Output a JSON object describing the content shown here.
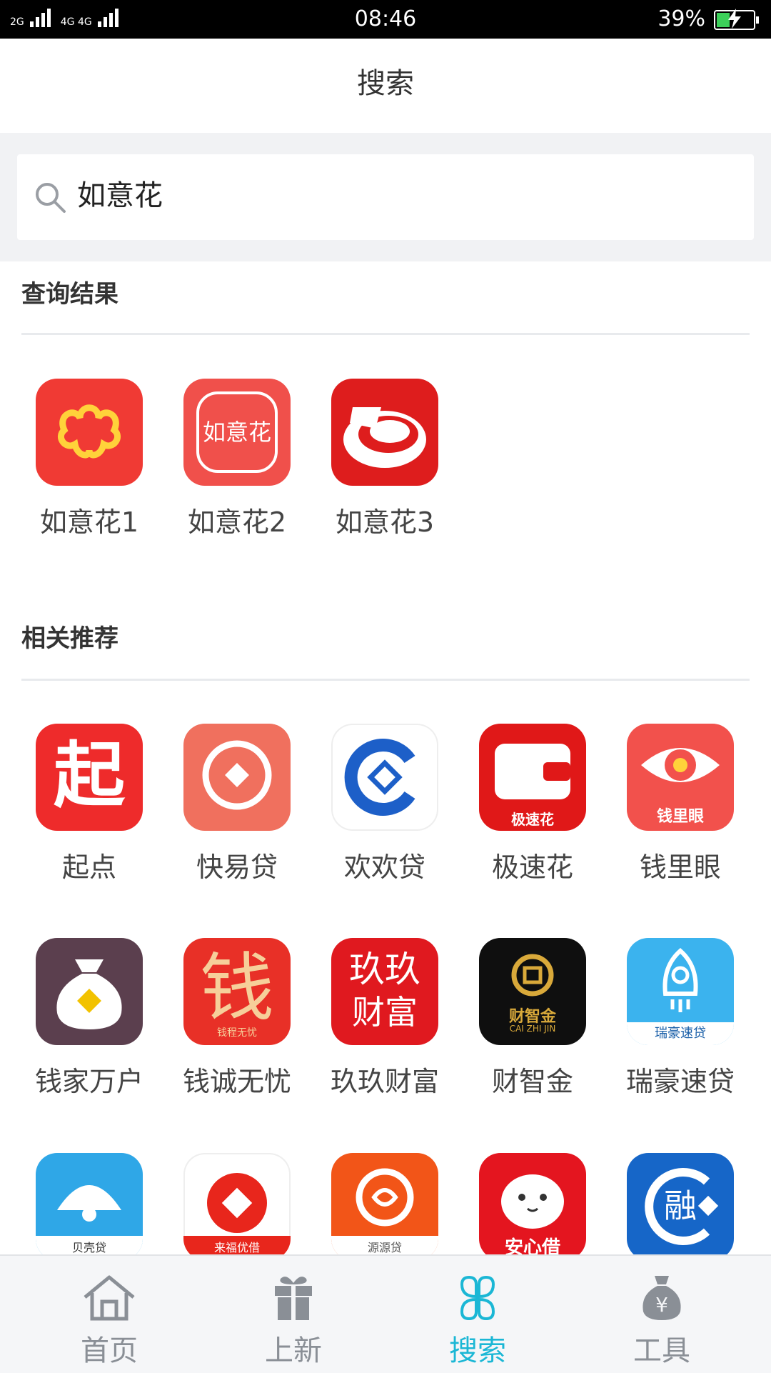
{
  "status_bar": {
    "network_left": "2G",
    "network_right": "4G 4G",
    "time": "08:46",
    "battery_percent": "39%",
    "battery_level": 0.39,
    "battery_color": "#3cd05a"
  },
  "header": {
    "title": "搜索"
  },
  "search": {
    "value": "如意花"
  },
  "results": {
    "title": "查询结果",
    "items": [
      {
        "label": "如意花1",
        "icon": "ruyihua1-app-icon",
        "color": "#f03a34"
      },
      {
        "label": "如意花2",
        "icon": "ruyihua2-app-icon",
        "color": "#f0504b",
        "icon_text": "如意花"
      },
      {
        "label": "如意花3",
        "icon": "ruyihua3-app-icon",
        "color": "#de1d1d"
      }
    ]
  },
  "recommend": {
    "title": "相关推荐",
    "items": [
      {
        "label": "起点",
        "icon": "qidian-app-icon",
        "color": "#ee2b2b",
        "icon_text": "起"
      },
      {
        "label": "快易贷",
        "icon": "kuaiyidai-app-icon",
        "color": "#f0705e"
      },
      {
        "label": "欢欢贷",
        "icon": "huanhuandai-app-icon",
        "color": "#ffffff"
      },
      {
        "label": "极速花",
        "icon": "jisuhua-app-icon",
        "color": "#e01818",
        "icon_text": "极速花"
      },
      {
        "label": "钱里眼",
        "icon": "qianliyan-app-icon",
        "color": "#f2514c",
        "icon_text": "钱里眼"
      },
      {
        "label": "钱家万户",
        "icon": "qianjiawanhu-app-icon",
        "color": "#5b3f4e"
      },
      {
        "label": "钱诚无忧",
        "icon": "qianchengwuyou-app-icon",
        "color": "#e83027",
        "icon_text": "钱",
        "icon_subtext": "钱程无忧"
      },
      {
        "label": "玖玖财富",
        "icon": "jiujiucaifu-app-icon",
        "color": "#e0191f",
        "icon_text": "玖玖",
        "icon_subtext": "财富"
      },
      {
        "label": "财智金",
        "icon": "caizhijin-app-icon",
        "color": "#0f0f0f",
        "icon_text": "财智金",
        "icon_subtext": "CAI ZHI JIN"
      },
      {
        "label": "瑞豪速贷",
        "icon": "ruihaosudai-app-icon",
        "color": "#3bb3ee",
        "icon_text": "瑞豪速贷"
      },
      {
        "label": "",
        "icon": "beikedai-app-icon",
        "color": "#2fa7e7",
        "icon_text": "贝壳贷"
      },
      {
        "label": "",
        "icon": "laifuyoujie-app-icon",
        "color": "#ffffff",
        "icon_text": "来福优借"
      },
      {
        "label": "",
        "icon": "yuanyuandai-app-icon",
        "color": "#f25518",
        "icon_text": "源源贷"
      },
      {
        "label": "",
        "icon": "anxinjie-app-icon",
        "color": "#e4151f",
        "icon_text": "安心借"
      },
      {
        "label": "",
        "icon": "rong-app-icon",
        "color": "#1666c8",
        "icon_text": "融"
      }
    ]
  },
  "bottom_nav": {
    "items": [
      {
        "label": "首页",
        "icon": "home-icon"
      },
      {
        "label": "上新",
        "icon": "gift-icon"
      },
      {
        "label": "搜索",
        "icon": "clover-icon",
        "active": true
      },
      {
        "label": "工具",
        "icon": "money-bag-icon"
      }
    ],
    "active_color": "#1bb7d5",
    "inactive_color": "#8a8f96"
  }
}
